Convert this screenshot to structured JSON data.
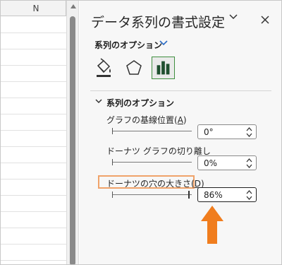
{
  "sheet": {
    "column_header": "N"
  },
  "pane": {
    "title": "データ系列の書式設定",
    "options_label": "系列のオプション",
    "tabs": [
      {
        "name": "fill-line",
        "icon": "paint-bucket-icon"
      },
      {
        "name": "effects",
        "icon": "pentagon-icon"
      },
      {
        "name": "series-options",
        "icon": "bar-chart-icon"
      }
    ],
    "section_title": "系列のオプション",
    "fields": [
      {
        "label": "グラフの基線位置(",
        "accel": "A",
        "label_end": ")",
        "value": "0°"
      },
      {
        "label": "ドーナツ グラフの切り離し",
        "accel": "",
        "label_end": "",
        "value": "0%"
      },
      {
        "label": "ドーナツの穴の大きさ(",
        "accel": "D",
        "label_end": ")",
        "value": "86%"
      }
    ]
  },
  "colors": {
    "accent_green": "#217346",
    "highlight_orange": "#f0a36a",
    "arrow_orange": "#f07d1e",
    "chevron_blue": "#2b6cc4"
  }
}
